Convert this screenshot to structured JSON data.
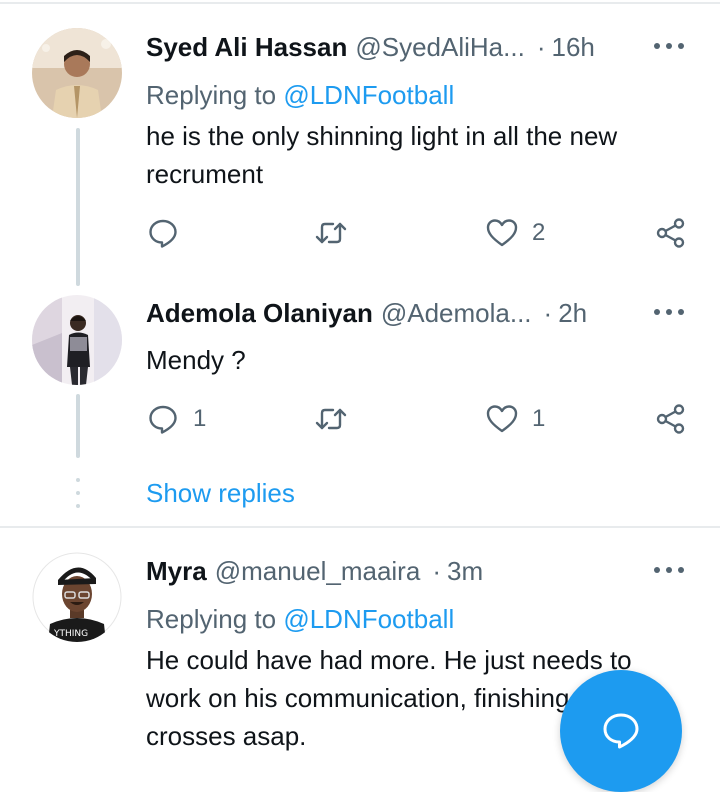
{
  "tweets": [
    {
      "name": "Syed Ali Hassan",
      "handle": "@SyedAliHa...",
      "sep": "·",
      "time": "16h",
      "replying_prefix": "Replying to ",
      "replying_handle": "@LDNFootball",
      "text_line1": "he is the only shinning light in all the new",
      "text_line2": "recrument",
      "reply_count": "",
      "retweet_count": "",
      "like_count": "2"
    },
    {
      "name": "Ademola Olaniyan",
      "handle": "@Ademola...",
      "sep": "·",
      "time": "2h",
      "text_line1": "Mendy ?",
      "reply_count": "1",
      "retweet_count": "",
      "like_count": "1"
    },
    {
      "name": "Myra",
      "handle": "@manuel_maaira",
      "sep": "·",
      "time": "3m",
      "replying_prefix": "Replying to ",
      "replying_handle": "@LDNFootball",
      "text_line1": "He could have had more. He just needs to",
      "text_line2": "work on his communication, finishing",
      "text_line3": "crosses asap."
    }
  ],
  "show_replies": "Show replies",
  "avatar3_shirt_text": "YTHING",
  "colors": {
    "accent": "#1d9bf0",
    "secondary_text": "#536471",
    "primary_text": "#0f1419",
    "thread_line": "#cfd9de"
  },
  "icons": [
    "reply-icon",
    "retweet-icon",
    "like-icon",
    "share-icon",
    "more-icon",
    "compose-icon"
  ]
}
